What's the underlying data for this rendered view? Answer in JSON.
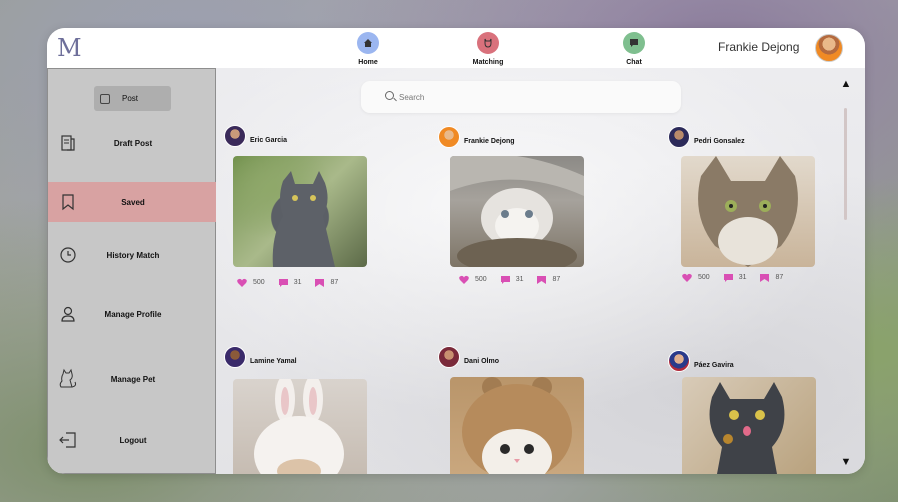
{
  "nav": {
    "logo": "M",
    "items": [
      {
        "label": "Home",
        "icon": "home-icon",
        "color": "#9bb6f0"
      },
      {
        "label": "Matching",
        "icon": "cat-icon",
        "color": "#d9717c"
      },
      {
        "label": "Chat",
        "icon": "chat-icon",
        "color": "#7fbf8f"
      }
    ],
    "user_name": "Frankie Dejong"
  },
  "sidebar": {
    "post_label": "Post",
    "items": [
      {
        "label": "Draft Post",
        "icon": "draft-icon",
        "active": false
      },
      {
        "label": "Saved",
        "icon": "bookmark-icon",
        "active": true
      },
      {
        "label": "History Match",
        "icon": "clock-icon",
        "active": false
      },
      {
        "label": "Manage Profile",
        "icon": "user-icon",
        "active": false
      },
      {
        "label": "Manage Pet",
        "icon": "cat-outline-icon",
        "active": false
      },
      {
        "label": "Logout",
        "icon": "logout-icon",
        "active": false
      }
    ],
    "active_color": "#d8a2a2"
  },
  "search": {
    "placeholder": "Search"
  },
  "posts": [
    {
      "author": "Eric Garcia",
      "likes": "500",
      "comments": "31",
      "saves": "87",
      "image": "grey cat"
    },
    {
      "author": "Frankie Dejong",
      "likes": "500",
      "comments": "31",
      "saves": "87",
      "image": "fluffy white cat"
    },
    {
      "author": "Pedri Gonsalez",
      "likes": "500",
      "comments": "31",
      "saves": "87",
      "image": "maine coon cat"
    },
    {
      "author": "Lamine Yamal",
      "image": "cat in bunny hat"
    },
    {
      "author": "Dani Olmo",
      "image": "kitten in bear hat"
    },
    {
      "author": "Páez Gavira",
      "image": "grey cat with tongue"
    }
  ],
  "colors": {
    "accent": "#d94fb4",
    "window_bg": "#f4f4f6",
    "sidebar_bg": "#c7c7c7"
  }
}
